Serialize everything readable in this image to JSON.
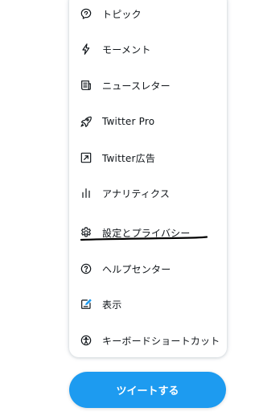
{
  "menu": {
    "items": [
      {
        "label": "トピック",
        "icon": "topics-icon"
      },
      {
        "label": "モーメント",
        "icon": "moments-icon"
      },
      {
        "label": "ニュースレター",
        "icon": "newsletter-icon"
      },
      {
        "label": "Twitter Pro",
        "icon": "rocket-icon"
      },
      {
        "label": "Twitter広告",
        "icon": "ads-icon"
      },
      {
        "label": "アナリティクス",
        "icon": "analytics-icon"
      },
      {
        "label": "設定とプライバシー",
        "icon": "gear-icon"
      },
      {
        "label": "ヘルプセンター",
        "icon": "help-icon"
      },
      {
        "label": "表示",
        "icon": "display-icon"
      },
      {
        "label": "キーボードショートカット",
        "icon": "accessibility-icon"
      }
    ]
  },
  "tweet_button": {
    "label": "ツイートする"
  },
  "colors": {
    "accent": "#1d9bf0",
    "text": "#0f1419",
    "icon": "#0f1419"
  }
}
